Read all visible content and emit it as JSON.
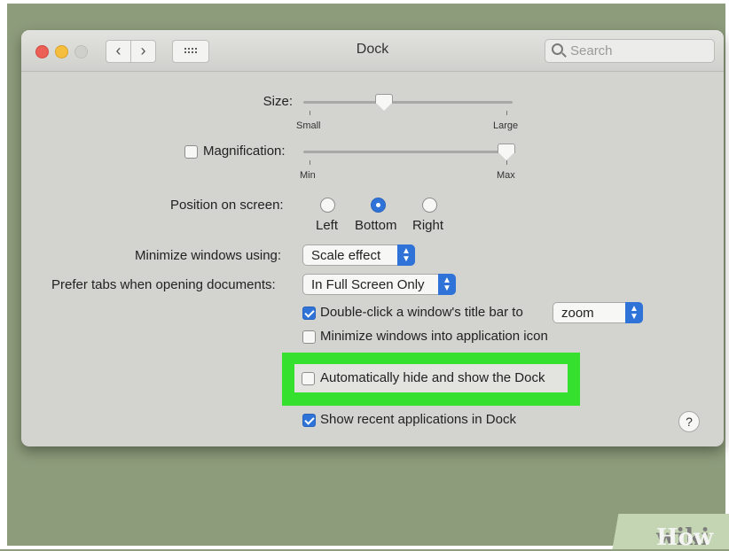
{
  "window": {
    "title": "Dock",
    "search_placeholder": "Search",
    "nav_back": "‹",
    "nav_forward": "›"
  },
  "size": {
    "label": "Size:",
    "min_label": "Small",
    "max_label": "Large",
    "level": 0.38
  },
  "magnification": {
    "label": "Magnification:",
    "checked": false,
    "min_label": "Min",
    "max_label": "Max",
    "level": 1.0
  },
  "position": {
    "label": "Position on screen:",
    "options": [
      "Left",
      "Bottom",
      "Right"
    ],
    "selected": "Bottom"
  },
  "minimize": {
    "label": "Minimize windows using:",
    "value": "Scale effect"
  },
  "prefer_tabs": {
    "label": "Prefer tabs when opening documents:",
    "value": "In Full Screen Only"
  },
  "double_click": {
    "label": "Double-click a window's title bar to",
    "checked": true,
    "value": "zoom"
  },
  "minimize_into_icon": {
    "label": "Minimize windows into application icon",
    "checked": false
  },
  "auto_hide": {
    "label": "Automatically hide and show the Dock",
    "checked": false
  },
  "show_recent": {
    "label": "Show recent applications in Dock",
    "checked": true
  },
  "help_label": "?",
  "watermark": {
    "part1": "wiki",
    "part2": "How"
  },
  "colors": {
    "accent": "#2f73d9",
    "highlight": "#35e02e",
    "background": "#8d9c7b"
  }
}
